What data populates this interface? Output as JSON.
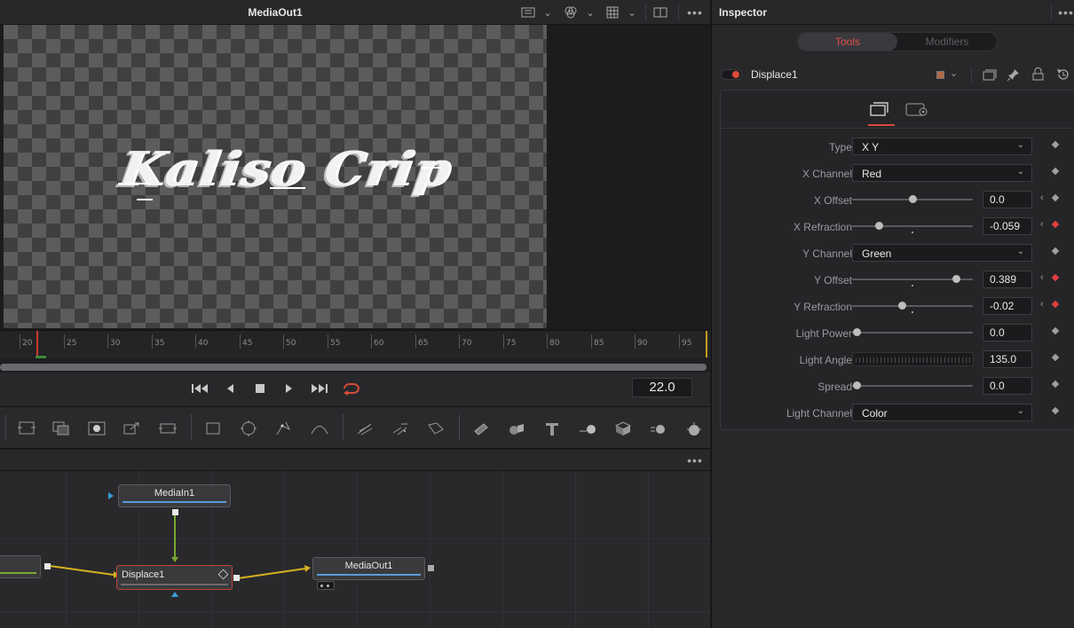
{
  "viewer": {
    "title": "MediaOut1",
    "rendered_text": "Kaliso Crip"
  },
  "timeline": {
    "ticks": [
      "20",
      "25",
      "30",
      "35",
      "40",
      "45",
      "50",
      "55",
      "60",
      "65",
      "70",
      "75",
      "80",
      "85",
      "90",
      "95"
    ],
    "current_frame": "22.0"
  },
  "node_editor": {
    "nodes": {
      "media_in": "MediaIn1",
      "displace": "Displace1",
      "media_out": "MediaOut1"
    }
  },
  "inspector": {
    "title": "Inspector",
    "tabs": {
      "tools": "Tools",
      "modifiers": "Modifiers"
    },
    "node_name": "Displace1",
    "params": {
      "type": {
        "label": "Type",
        "value": "X Y"
      },
      "x_channel": {
        "label": "X Channel",
        "value": "Red"
      },
      "x_offset": {
        "label": "X Offset",
        "value": "0.0"
      },
      "x_refraction": {
        "label": "X Refraction",
        "value": "-0.059"
      },
      "y_channel": {
        "label": "Y Channel",
        "value": "Green"
      },
      "y_offset": {
        "label": "Y Offset",
        "value": "0.389"
      },
      "y_refraction": {
        "label": "Y Refraction",
        "value": "-0.02"
      },
      "light_power": {
        "label": "Light Power",
        "value": "0.0"
      },
      "light_angle": {
        "label": "Light Angle",
        "value": "135.0"
      },
      "spread": {
        "label": "Spread",
        "value": "0.0"
      },
      "light_channel": {
        "label": "Light Channel",
        "value": "Color"
      }
    }
  },
  "colors": {
    "accent_red": "#d94a3a",
    "keyframe_active": "#e04040",
    "node_displace_border": "#c0433a",
    "media_in_bar": "#5a9ad8",
    "link_yellow": "#d8b020",
    "link_green": "#7aa830"
  }
}
